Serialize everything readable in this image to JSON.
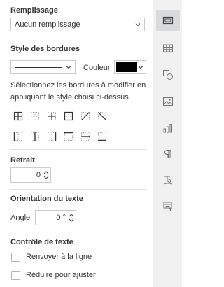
{
  "fill": {
    "title": "Remplissage",
    "value": "Aucun remplissage"
  },
  "borders": {
    "title": "Style des bordures",
    "color_label": "Couleur",
    "color_value": "#000000",
    "instruction": "Sélectionnez les bordures à modifier en appliquant le style choisi ci-dessus",
    "buttons": [
      "border-all-icon",
      "border-none-icon",
      "border-inner-icon",
      "border-outer-icon",
      "border-diagonal-up-icon",
      "border-diagonal-down-icon",
      "border-left-icon",
      "border-inner-vertical-icon",
      "border-right-icon",
      "border-top-icon",
      "border-inner-horizontal-icon",
      "border-bottom-icon"
    ]
  },
  "indent": {
    "title": "Retrait",
    "value": "0"
  },
  "orientation": {
    "title": "Orientation du texte",
    "angle_label": "Angle",
    "angle_value": "0 °"
  },
  "text_control": {
    "title": "Contrôle de texte",
    "wrap_label": "Renvoyer à la ligne",
    "shrink_label": "Réduire pour ajuster"
  },
  "rail": {
    "icons": [
      "cell-settings-icon",
      "table-icon",
      "shape-icon",
      "image-icon",
      "chart-icon",
      "paragraph-icon",
      "text-art-icon",
      "pivot-table-icon"
    ],
    "active": "cell-settings-icon"
  }
}
